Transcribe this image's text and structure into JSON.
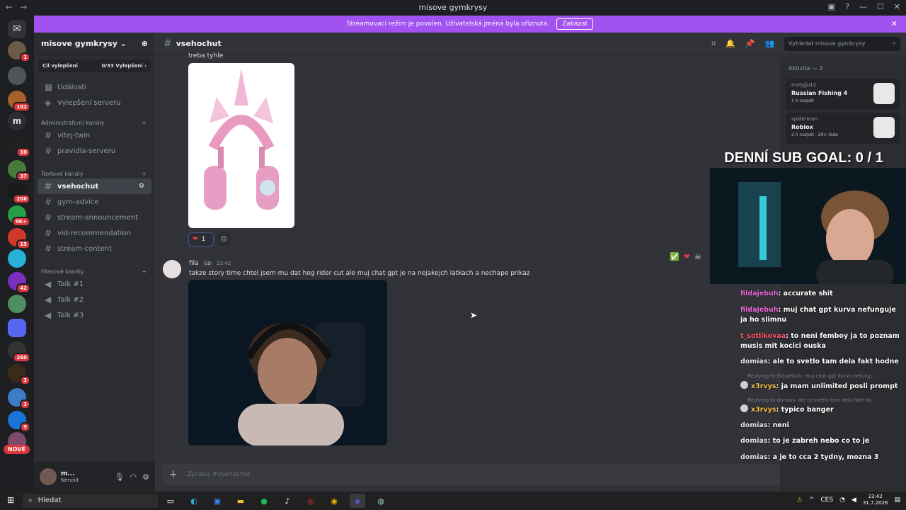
{
  "window": {
    "title": "misove gymkrysy",
    "back": "←",
    "forward": "→"
  },
  "banner": {
    "text": "Streamovací režim je povolen. Uživatelská jména byla oříznuta.",
    "button": "Zakázat",
    "close": "✕"
  },
  "servers": {
    "badges": [
      "1",
      "102",
      "10",
      "37",
      "206",
      "9K+",
      "15",
      "42",
      "260",
      "3",
      "3",
      "9"
    ],
    "letter": "m",
    "new_label": "NOVÉ"
  },
  "guild": {
    "name": "misove gymkrysy",
    "chevron": "⌄",
    "boost_label": "Cíl vylepšení",
    "boost_progress": "0/33 Vylepšení",
    "boost_arrow": "›",
    "top_items": [
      "Události",
      "Vylepšení serveru"
    ],
    "categories": [
      {
        "name": "Administrativní kanály",
        "channels": [
          "vitej-twin",
          "pravidla-serveru"
        ]
      },
      {
        "name": "Textové kanály",
        "channels": [
          "vsehochut",
          "gym-advice",
          "stream-announcement",
          "vid-recommendation",
          "stream-content"
        ]
      },
      {
        "name": "Hlasové kanály",
        "channels": [
          "Talk #1",
          "Talk #2",
          "Talk #3"
        ]
      }
    ]
  },
  "user_panel": {
    "name": "m...",
    "status": "Nerušit"
  },
  "channel": {
    "name": "vsehochut",
    "search_placeholder": "Vyhledat misove gymkrysy"
  },
  "messages": {
    "m1_text": "treba tyhle",
    "m1_reaction_count": "1",
    "m2_author": "fila",
    "m2_tag": "GD",
    "m2_time": "23:42",
    "m2_text": "takze story time chtel jsem mu dat hog rider cut ale muj chat gpt je na nejakejch latkach a nechape prikaz"
  },
  "composer": {
    "placeholder": "Zpráva #vsehochut"
  },
  "members": {
    "header": "Aktivita — 2",
    "activities": [
      {
        "user": "matyjju12",
        "game": "Russian Fishing 4",
        "detail": "1 h nazpět"
      },
      {
        "user": "spiderman",
        "game": "Roblox",
        "detail": "2 h nazpět · 29× řada"
      }
    ]
  },
  "overlay": {
    "title": "DENNÍ SUB GOAL: 0 / 1",
    "chat": [
      {
        "user": "fildajebuh",
        "text": "accurate shit",
        "color": "pink"
      },
      {
        "user": "fildajebuh",
        "text": "muj chat gpt kurva nefunguje ja ho slimnu",
        "color": "pink"
      },
      {
        "user": "t_sotlikovaa",
        "text": "to neni femboy ja to poznam musis mit kocici ouska",
        "color": "red"
      },
      {
        "user": "domias",
        "text": "ale to svetlo tam dela fakt hodne",
        "color": "gray"
      },
      {
        "user": "x3rvys",
        "text": "ja mam unlimited posli prompt",
        "color": "gold"
      },
      {
        "user": "x3rvys",
        "text": "typico banger",
        "color": "gold"
      },
      {
        "user": "domias",
        "text": "neni",
        "color": "gray"
      },
      {
        "user": "domias",
        "text": "to je zabreh nebo co to je",
        "color": "gray"
      },
      {
        "user": "domias",
        "text": "a je to cca 2 tydny, mozna 3",
        "color": "gray"
      }
    ],
    "reply1": "Replying to fildajebuh: muj chat gpt kurva nefung...",
    "reply2": "Replying to domias: ale to svetlo tam dela fakt ho..."
  },
  "taskbar": {
    "search": "Hledat",
    "lang": "CES",
    "time": "23:42",
    "date": "31.7.2026"
  }
}
